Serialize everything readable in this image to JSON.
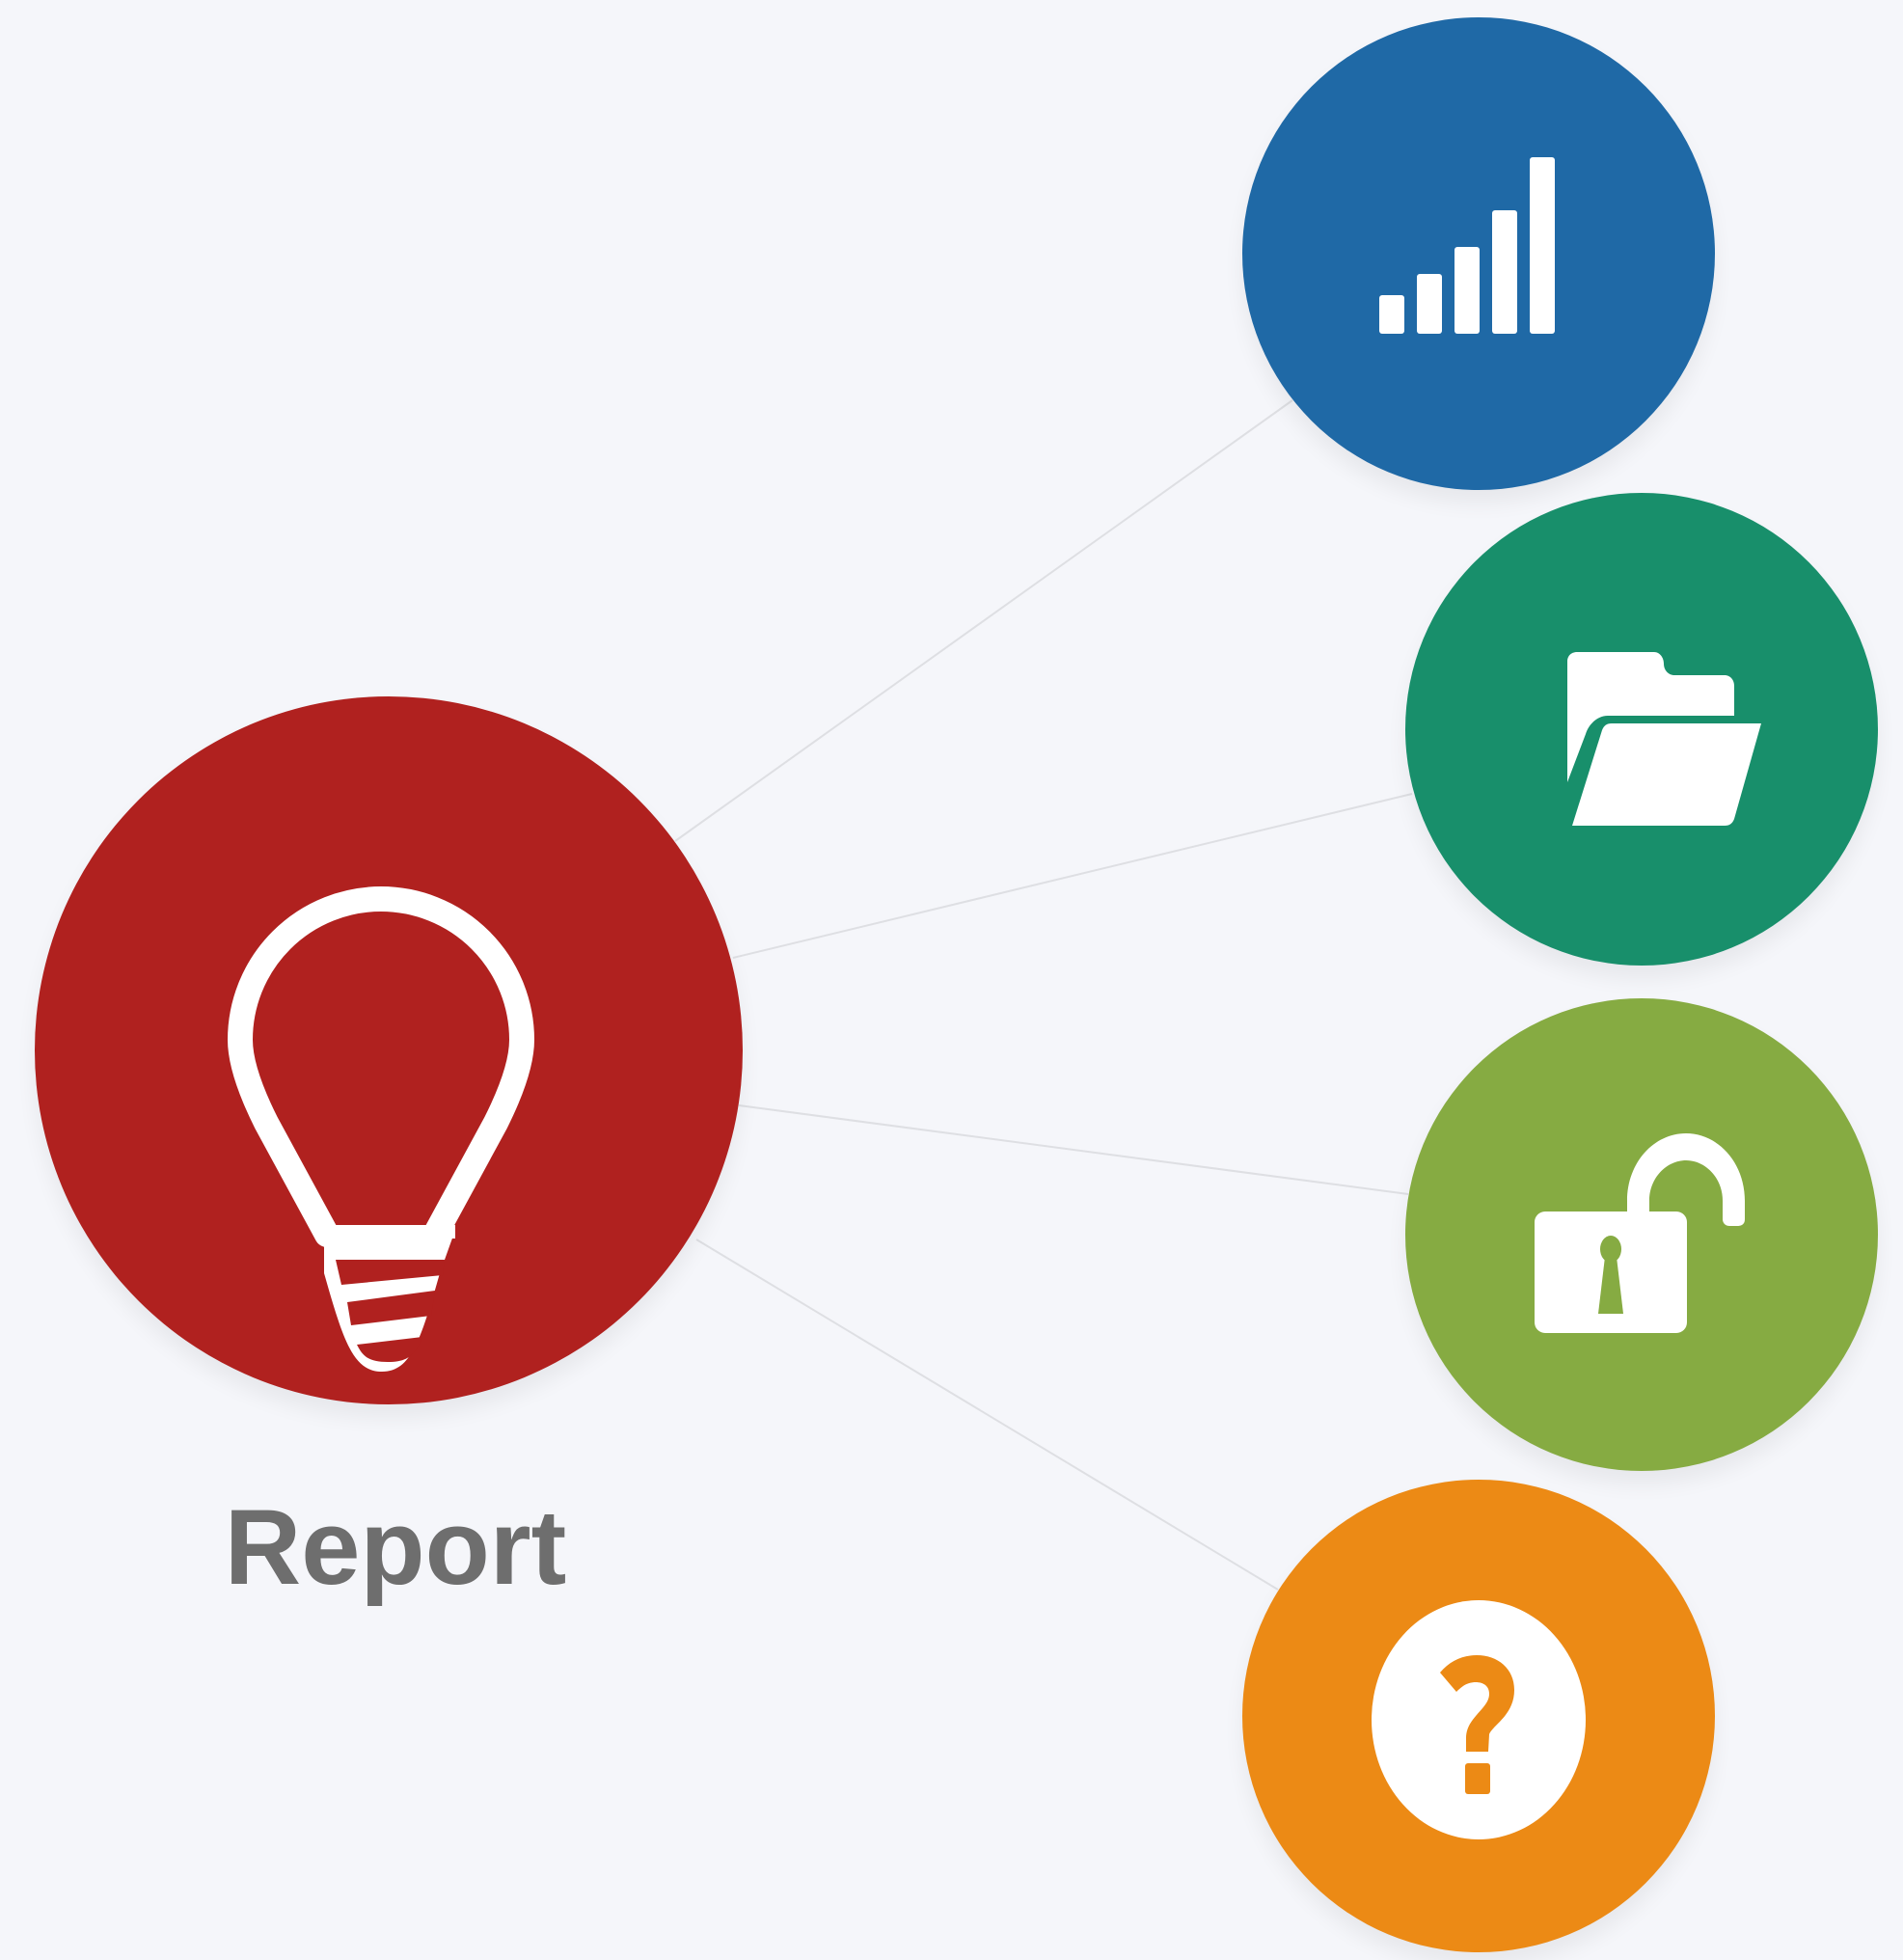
{
  "colors": {
    "background": "#f5f6fa",
    "connector": "#dedfe3",
    "icon": "#ffffff",
    "label": "#6e6e6e"
  },
  "hub": {
    "label": "Report",
    "icon": "lightbulb-icon",
    "color": "#b0211f"
  },
  "nodes": [
    {
      "icon": "signal-bars-icon",
      "color": "#1f69a6"
    },
    {
      "icon": "open-folder-icon",
      "color": "#188f6b"
    },
    {
      "icon": "unlocked-padlock-icon",
      "color": "#86ab42"
    },
    {
      "icon": "question-mark-icon",
      "color": "#ec8a15"
    }
  ]
}
